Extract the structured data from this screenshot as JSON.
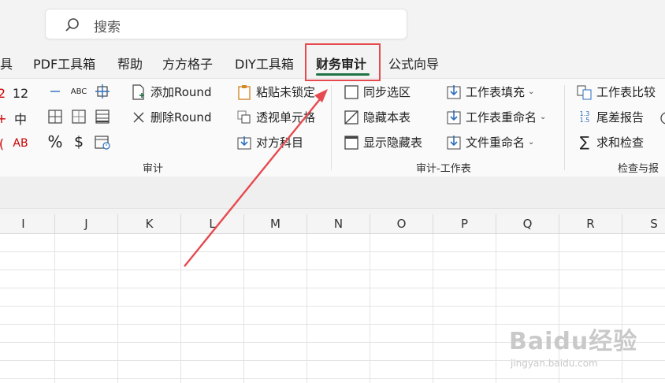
{
  "search": {
    "placeholder": "搜索"
  },
  "tabs": [
    {
      "label": "具"
    },
    {
      "label": "PDF工具箱"
    },
    {
      "label": "帮助"
    },
    {
      "label": "方方格子"
    },
    {
      "label": "DIY工具箱"
    },
    {
      "label": "财务审计",
      "active": true
    },
    {
      "label": "公式向导"
    }
  ],
  "ribbon": {
    "left_partial": {
      "row1": "12",
      "row2": "中",
      "row3": "AB"
    },
    "format": {
      "abc": "ABC",
      "percent": "%",
      "dollar": "$"
    },
    "round": {
      "add": "添加Round",
      "remove": "删除Round"
    },
    "paste": {
      "paste_unlocked": "粘贴未锁定",
      "perspective": "透视单元格",
      "counterpart": "对方科目"
    },
    "group1_label": "审计",
    "sheet": {
      "sync_select": "同步选区",
      "hide_sheet": "隐藏本表",
      "show_hidden": "显示隐藏表",
      "fill": "工作表填充",
      "rename": "工作表重命名",
      "file_rename": "文件重命名"
    },
    "group2_label": "审计-工作表",
    "check": {
      "compare": "工作表比较",
      "diff_report": "尾差报告",
      "sum_check": "求和检查",
      "diff_icon_text": "1.3\n1.5"
    },
    "group3_label": "检查与报"
  },
  "columns": [
    "I",
    "J",
    "K",
    "L",
    "M",
    "N",
    "O",
    "P",
    "Q",
    "R",
    "S"
  ],
  "watermark": {
    "brand": "Baidu经验",
    "url": "jingyan.baidu.com"
  },
  "colors": {
    "accent": "#217346",
    "highlight": "#e64a4f",
    "arrow": "#e64a4f"
  }
}
